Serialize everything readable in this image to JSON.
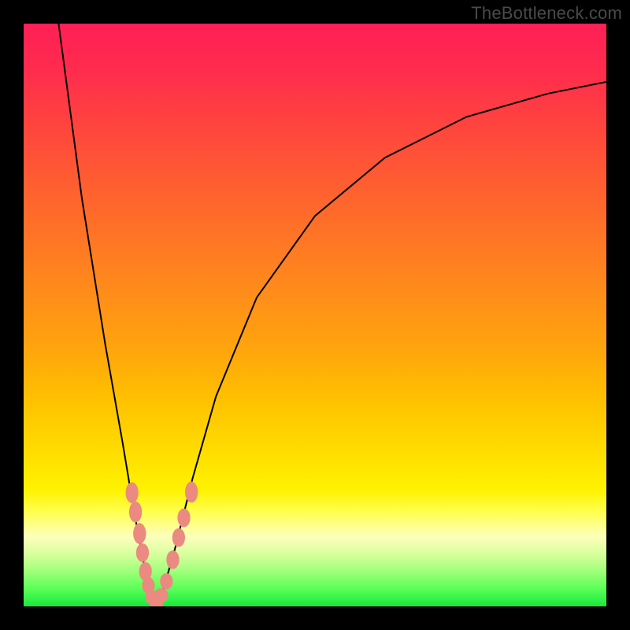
{
  "watermark": "TheBottleneck.com",
  "chart_data": {
    "type": "line",
    "title": "",
    "xlabel": "",
    "ylabel": "",
    "xlim": [
      0,
      100
    ],
    "ylim": [
      0,
      100
    ],
    "grid": false,
    "legend": false,
    "background_gradient": {
      "top": "#ff1f56",
      "bottom": "#17e83d",
      "meaning": "red (high bottleneck) to green (no bottleneck)"
    },
    "series": [
      {
        "name": "left-branch",
        "x": [
          6.0,
          10.0,
          14.0,
          17.0,
          19.0,
          20.5,
          21.5,
          22.5
        ],
        "y": [
          100.0,
          70.0,
          45.0,
          28.0,
          16.0,
          8.0,
          3.0,
          0.5
        ]
      },
      {
        "name": "right-branch",
        "x": [
          22.5,
          24.0,
          26.0,
          29.0,
          33.0,
          40.0,
          50.0,
          62.0,
          76.0,
          90.0,
          100.0
        ],
        "y": [
          0.5,
          3.0,
          10.0,
          22.0,
          36.0,
          53.0,
          67.0,
          77.0,
          84.0,
          88.0,
          90.0
        ]
      }
    ],
    "markers": {
      "name": "highlighted-points",
      "color": "#eb8a80",
      "points": [
        {
          "x": 18.6,
          "y": 19.5,
          "rx": 1.1,
          "ry": 1.8
        },
        {
          "x": 19.2,
          "y": 16.2,
          "rx": 1.1,
          "ry": 1.8
        },
        {
          "x": 19.9,
          "y": 12.5,
          "rx": 1.1,
          "ry": 1.8
        },
        {
          "x": 20.4,
          "y": 9.2,
          "rx": 1.1,
          "ry": 1.6
        },
        {
          "x": 20.9,
          "y": 6.0,
          "rx": 1.1,
          "ry": 1.6
        },
        {
          "x": 21.4,
          "y": 3.6,
          "rx": 1.1,
          "ry": 1.4
        },
        {
          "x": 22.0,
          "y": 1.6,
          "rx": 1.2,
          "ry": 1.2
        },
        {
          "x": 22.8,
          "y": 0.6,
          "rx": 1.2,
          "ry": 1.2
        },
        {
          "x": 23.6,
          "y": 1.9,
          "rx": 1.2,
          "ry": 1.2
        },
        {
          "x": 24.5,
          "y": 4.3,
          "rx": 1.1,
          "ry": 1.4
        },
        {
          "x": 25.6,
          "y": 8.0,
          "rx": 1.1,
          "ry": 1.6
        },
        {
          "x": 26.6,
          "y": 11.8,
          "rx": 1.1,
          "ry": 1.6
        },
        {
          "x": 27.5,
          "y": 15.2,
          "rx": 1.1,
          "ry": 1.6
        },
        {
          "x": 28.8,
          "y": 19.6,
          "rx": 1.1,
          "ry": 1.8
        }
      ]
    }
  }
}
